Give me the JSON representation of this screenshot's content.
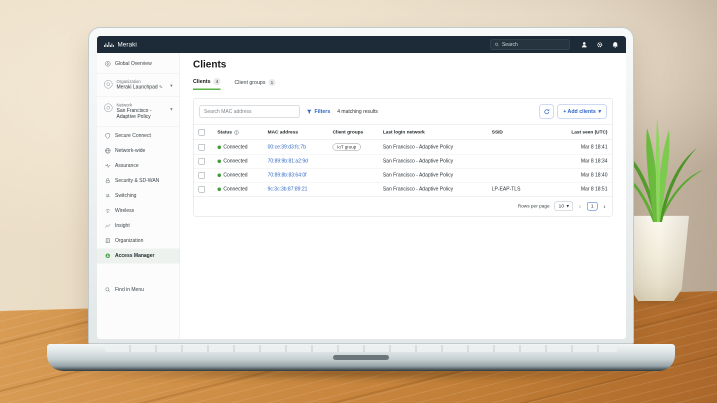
{
  "topbar": {
    "brand": "Meraki",
    "search_placeholder": "Search"
  },
  "sidebar": {
    "global_overview": "Global Overview",
    "org_selector": {
      "section": "Organization",
      "name": "Meraki Launchpad"
    },
    "network_selector": {
      "section": "Network",
      "name": "San Francisco - Adaptive Policy"
    },
    "items": [
      {
        "label": "Secure Connect"
      },
      {
        "label": "Network-wide"
      },
      {
        "label": "Assurance"
      },
      {
        "label": "Security & SD-WAN"
      },
      {
        "label": "Switching"
      },
      {
        "label": "Wireless"
      },
      {
        "label": "Insight"
      },
      {
        "label": "Organization"
      },
      {
        "label": "Access Manager"
      }
    ],
    "find_in_menu": "Find in Menu"
  },
  "page": {
    "title": "Clients",
    "tabs": [
      {
        "label": "Clients",
        "count": "4"
      },
      {
        "label": "Client groups",
        "count": "1"
      }
    ]
  },
  "toolbar": {
    "search_placeholder": "Search MAC address",
    "filters_label": "Filters",
    "results_text": "4 matching results",
    "add_clients_label": "+ Add clients"
  },
  "table": {
    "columns": [
      "Status",
      "MAC address",
      "Client groups",
      "Last login network",
      "SSID",
      "Last seen (UTC)"
    ],
    "rows": [
      {
        "status": "Connected",
        "mac": "00:ce:39:d3:fc:7b",
        "group": "IoT group",
        "network": "San Francisco - Adaptive Policy",
        "ssid": "",
        "last_seen": "Mar 8 18:41"
      },
      {
        "status": "Connected",
        "mac": "70:89:9b:81:a2:9d",
        "group": "",
        "network": "San Francisco - Adaptive Policy",
        "ssid": "",
        "last_seen": "Mar 8 18:34"
      },
      {
        "status": "Connected",
        "mac": "70:89:8b:83:64:0f",
        "group": "",
        "network": "San Francisco - Adaptive Policy",
        "ssid": "",
        "last_seen": "Mar 8 18:40"
      },
      {
        "status": "Connected",
        "mac": "9c:3c:3b:87:89:21",
        "group": "",
        "network": "San Francisco - Adaptive Policy",
        "ssid": "LP-EAP-TLS",
        "last_seen": "Mar 8 18:51"
      }
    ]
  },
  "pagination": {
    "label": "Rows per page",
    "per_page": "10",
    "page": "1"
  },
  "colors": {
    "navy": "#1c2b37",
    "accent_green": "#5cb24a",
    "link_blue": "#2d66c4"
  }
}
